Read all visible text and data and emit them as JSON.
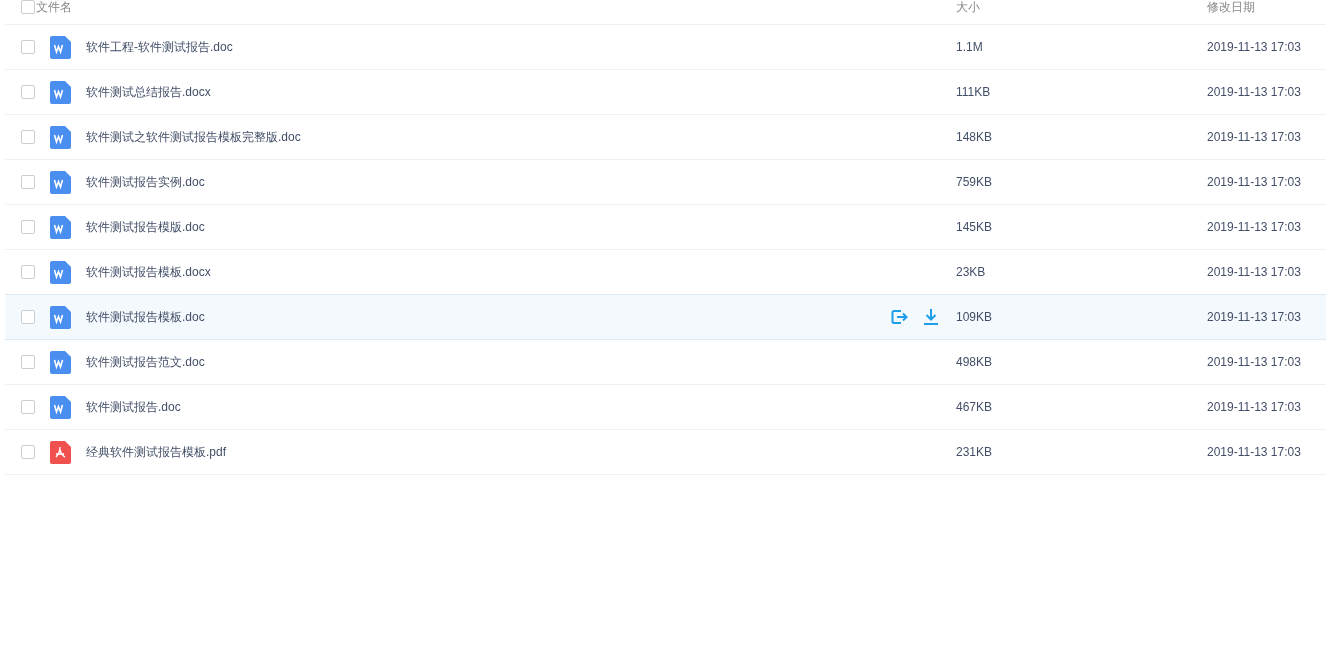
{
  "header": {
    "checked": false,
    "columns": [
      "文件名",
      "大小",
      "修改日期"
    ]
  },
  "files": [
    {
      "name": "软件工程-软件测试报告.doc",
      "kind": "word",
      "size": "1.1M",
      "modified": "2019-11-13 17:03",
      "checked": false,
      "hovered": false
    },
    {
      "name": "软件测试总结报告.docx",
      "kind": "word",
      "size": "111KB",
      "modified": "2019-11-13 17:03",
      "checked": false,
      "hovered": false
    },
    {
      "name": "软件测试之软件测试报告模板完整版.doc",
      "kind": "word",
      "size": "148KB",
      "modified": "2019-11-13 17:03",
      "checked": false,
      "hovered": false
    },
    {
      "name": "软件测试报告实例.doc",
      "kind": "word",
      "size": "759KB",
      "modified": "2019-11-13 17:03",
      "checked": false,
      "hovered": false
    },
    {
      "name": "软件测试报告模版.doc",
      "kind": "word",
      "size": "145KB",
      "modified": "2019-11-13 17:03",
      "checked": false,
      "hovered": false
    },
    {
      "name": "软件测试报告模板.docx",
      "kind": "word",
      "size": "23KB",
      "modified": "2019-11-13 17:03",
      "checked": false,
      "hovered": false
    },
    {
      "name": "软件测试报告模板.doc",
      "kind": "word",
      "size": "109KB",
      "modified": "2019-11-13 17:03",
      "checked": false,
      "hovered": true
    },
    {
      "name": "软件测试报告范文.doc",
      "kind": "word",
      "size": "498KB",
      "modified": "2019-11-13 17:03",
      "checked": false,
      "hovered": false
    },
    {
      "name": "软件测试报告.doc",
      "kind": "word",
      "size": "467KB",
      "modified": "2019-11-13 17:03",
      "checked": false,
      "hovered": false
    },
    {
      "name": "经典软件测试报告模板.pdf",
      "kind": "pdf",
      "size": "231KB",
      "modified": "2019-11-13 17:03",
      "checked": false,
      "hovered": false
    }
  ]
}
